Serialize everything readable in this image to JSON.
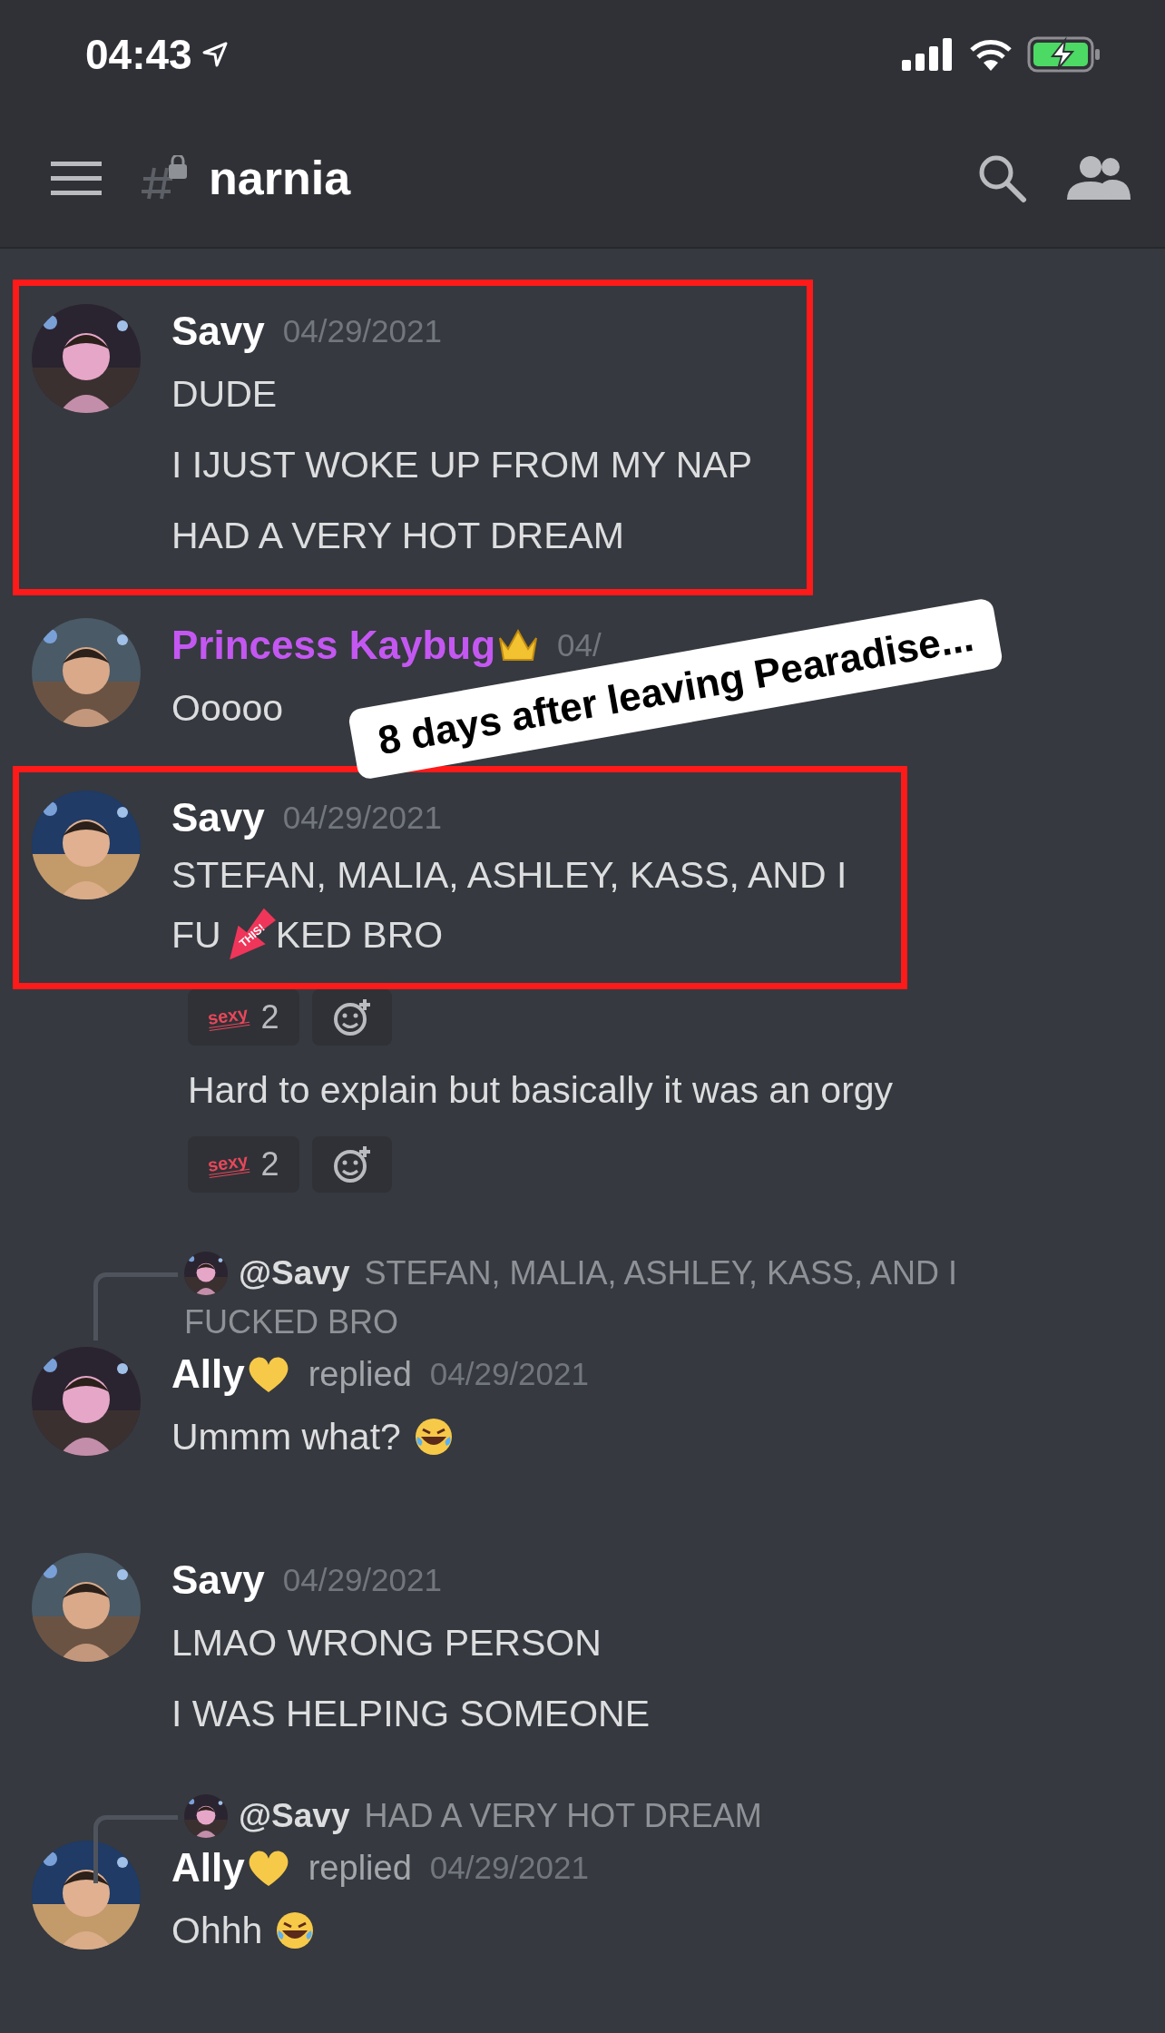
{
  "status_bar": {
    "time": "04:43"
  },
  "header": {
    "channel": "narnia"
  },
  "caption": "8 days after leaving Pearadise...",
  "feed": [
    {
      "kind": "message",
      "highlighted": true,
      "author": "Savy",
      "color": "#ffffff",
      "date": "04/29/2021",
      "paragraphs": [
        {
          "rows": [
            {
              "text": "DUDE"
            }
          ]
        },
        {
          "rows": [
            {
              "text": "I IJUST WOKE UP FROM MY NAP"
            }
          ]
        },
        {
          "rows": [
            {
              "text": "HAD A VERY HOT DREAM"
            }
          ]
        }
      ]
    },
    {
      "kind": "message",
      "highlighted": false,
      "author": "Princess Kaybug",
      "color": "#c457f2",
      "badge": {
        "kind": "crown"
      },
      "date": "04/",
      "paragraphs": [
        {
          "rows": [
            {
              "text": "Ooooo"
            }
          ]
        }
      ]
    },
    {
      "kind": "message",
      "highlighted": true,
      "author": "Savy",
      "color": "#ffffff",
      "date": "04/29/2021",
      "paragraphs": [
        {
          "rows": [
            {
              "text": "STEFAN,  MALIA, ASHLEY, KASS, AND I"
            },
            {
              "text": "FU",
              "sticker": "THIS!",
              "rest": "KED BRO"
            }
          ]
        }
      ]
    },
    {
      "kind": "reactions",
      "reactions": [
        {
          "label": "sexy",
          "count": "2"
        }
      ]
    },
    {
      "kind": "line",
      "text": "Hard to explain but basically it was an orgy"
    },
    {
      "kind": "reactions",
      "reactions": [
        {
          "label": "sexy",
          "count": "2"
        }
      ]
    },
    {
      "kind": "message",
      "highlighted": false,
      "author": "Ally",
      "color": "#ffffff",
      "badge": {
        "kind": "heart"
      },
      "replied": "replied",
      "reply": {
        "rows": [
          "**@Savy** STEFAN,  MALIA, ASHLEY, KASS, AND I",
          "FUCKED BRO"
        ]
      },
      "date": "04/29/2021",
      "paragraphs": [
        {
          "rows": [
            {
              "text": "Ummm what?",
              "emoji": {
                "kind": "laugh"
              }
            }
          ]
        }
      ]
    },
    {
      "kind": "message",
      "highlighted": false,
      "author": "Savy",
      "color": "#ffffff",
      "date": "04/29/2021",
      "paragraphs": [
        {
          "rows": [
            {
              "text": "LMAO WRONG PERSON"
            }
          ]
        },
        {
          "rows": [
            {
              "text": "I WAS HELPING SOMEONE"
            }
          ]
        }
      ]
    },
    {
      "kind": "message",
      "highlighted": false,
      "author": "Ally",
      "color": "#ffffff",
      "badge": {
        "kind": "heart"
      },
      "replied": "replied",
      "reply": {
        "rows": [
          "**@Savy** HAD A VERY HOT DREAM"
        ]
      },
      "date": "04/29/2021",
      "paragraphs": [
        {
          "rows": [
            {
              "text": "Ohhh",
              "emoji": {
                "kind": "laugh"
              }
            }
          ]
        }
      ]
    }
  ]
}
